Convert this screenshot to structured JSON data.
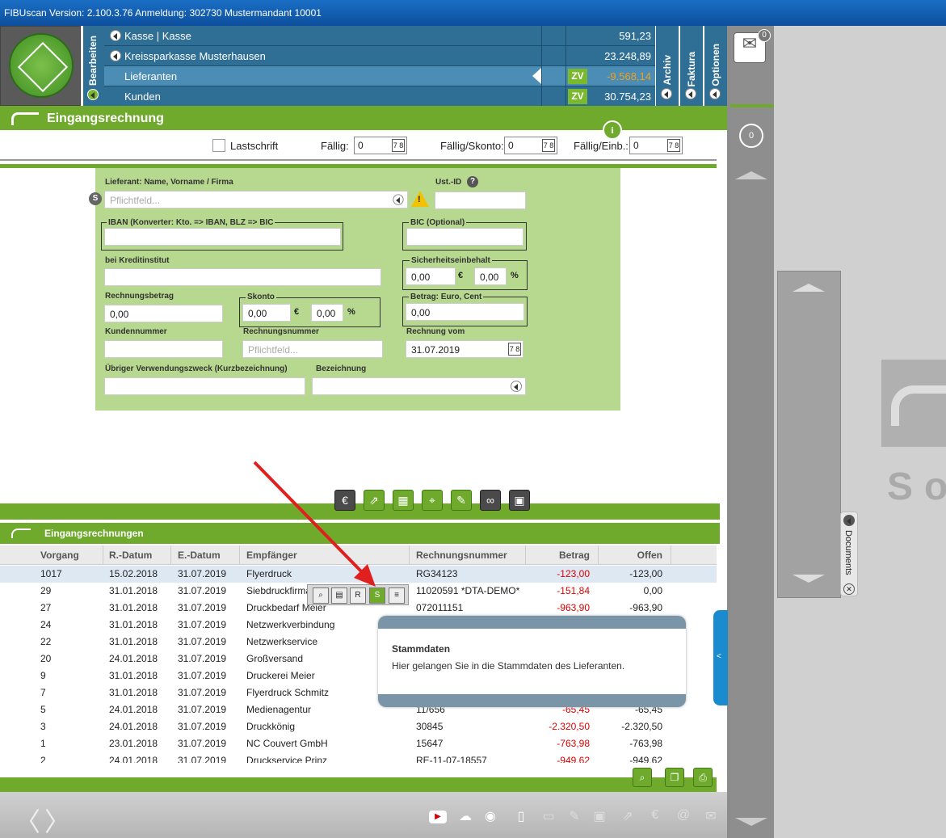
{
  "title_bar": "FIBUscan Version: 2.100.3.76 Anmeldung: 302730 Mustermandant 10001",
  "vertical_tabs": {
    "bearbeiten": "Bearbeiten",
    "archiv": "Archiv",
    "faktura": "Faktura",
    "optionen": "Optionen"
  },
  "accounts": [
    {
      "label": "Kasse | Kasse",
      "zv": "",
      "value": "591,23"
    },
    {
      "label": "Kreissparkasse Musterhausen",
      "zv": "",
      "value": "23.248,89"
    },
    {
      "label": "Lieferanten",
      "zv": "ZV",
      "value": "-9.568,14"
    },
    {
      "label": "Kunden",
      "zv": "ZV",
      "value": "30.754,23"
    }
  ],
  "colors": {
    "accent_green": "#6faa2c",
    "header_blue": "#2f6f95",
    "negative": "#dd0000",
    "orange_value": "#f0a020"
  },
  "section_title": "Eingangsrechnung",
  "filter": {
    "lastschrift": "Lastschrift",
    "faellig_label": "Fällig:",
    "faellig_value": "0",
    "skonto_label": "Fällig/Skonto:",
    "skonto_value": "0",
    "einb_label": "Fällig/Einb.:",
    "einb_value": "0",
    "cal_glyph": "7 8"
  },
  "form": {
    "lieferant_label": "Lieferant: Name, Vorname / Firma",
    "lieferant_placeholder": "Pflichtfeld...",
    "s_badge": "S",
    "ustid_label": "Ust.-ID",
    "help": "?",
    "iban_label": "IBAN (Konverter: Kto. => IBAN, BLZ => BIC",
    "bic_label": "BIC (Optional)",
    "kredit_label": "bei Kreditinstitut",
    "sicherheit_label": "Sicherheitseinbehalt",
    "sich_eur": "0,00",
    "sich_pct": "0,00",
    "euro_sym": "€",
    "pct_sym": "%",
    "betrag_label": "Rechnungsbetrag",
    "betrag_value": "0,00",
    "skonto_label": "Skonto",
    "skonto_eur": "0,00",
    "skonto_pct": "0,00",
    "betrag_ec_label": "Betrag: Euro, Cent",
    "betrag_ec_value": "0,00",
    "kundennr_label": "Kundennummer",
    "rechnr_label": "Rechnungsnummer",
    "rechnr_placeholder": "Pflichtfeld...",
    "rechvom_label": "Rechnung vom",
    "rechvom_value": "31.07.2019",
    "zweck_label": "Übriger Verwendungszweck (Kurzbezeichnung)",
    "bezeichnung_label": "Bezeichnung"
  },
  "list": {
    "title": "Eingangsrechnungen",
    "columns": [
      "Vorgang",
      "R.-Datum",
      "E.-Datum",
      "Empfänger",
      "Rechnungsnummer",
      "Betrag",
      "Offen"
    ],
    "rows": [
      [
        "1017",
        "15.02.2018",
        "31.07.2019",
        "Flyerdruck",
        "RG34123",
        "-123,00",
        "-123,00"
      ],
      [
        "29",
        "31.01.2018",
        "31.07.2019",
        "Siebdruckfirma",
        "11020591 *DTA-DEMO*",
        "-151,84",
        "0,00"
      ],
      [
        "27",
        "31.01.2018",
        "31.07.2019",
        "Druckbedarf Meier",
        "072011151",
        "-963,90",
        "-963,90"
      ],
      [
        "24",
        "31.01.2018",
        "31.07.2019",
        "Netzwerkverbindung",
        "",
        "",
        ""
      ],
      [
        "22",
        "31.01.2018",
        "31.07.2019",
        "Netzwerkservice",
        "",
        "",
        ""
      ],
      [
        "20",
        "24.01.2018",
        "31.07.2019",
        "Großversand",
        "",
        "",
        ""
      ],
      [
        "9",
        "31.01.2018",
        "31.07.2019",
        "Druckerei Meier",
        "",
        "",
        ""
      ],
      [
        "7",
        "31.01.2018",
        "31.07.2019",
        "Flyerdruck Schmitz",
        "",
        "",
        ""
      ],
      [
        "5",
        "24.01.2018",
        "31.07.2019",
        "Medienagentur",
        "11/656",
        "-65,45",
        "-65,45"
      ],
      [
        "3",
        "24.01.2018",
        "31.07.2019",
        "Druckkönig",
        "30845",
        "-2.320,50",
        "-2.320,50"
      ],
      [
        "1",
        "23.01.2018",
        "31.07.2019",
        "NC Couvert GmbH",
        "15647",
        "-763,98",
        "-763,98"
      ],
      [
        "2",
        "24.01.2018",
        "31.07.2019",
        "Druckservice Prinz",
        "RE-11-07-18557",
        "-949,62",
        "-949,62"
      ]
    ]
  },
  "tooltip": {
    "title": "Stammdaten",
    "text": "Hier gelangen Sie in die Stammdaten des Lieferanten."
  },
  "right": {
    "badge_count": "0",
    "mail_badge": "0",
    "documents": "Documents",
    "so_text": "So",
    "tab_arrow": "<"
  },
  "icons": [
    "logo-icon",
    "euro-icon",
    "export-icon",
    "basket-icon",
    "location-icon",
    "edit-icon",
    "infinity-icon",
    "save-icon",
    "search-icon",
    "copy-icon",
    "print-icon",
    "youtube-icon",
    "cloud-icon",
    "eye-icon",
    "mail-icon",
    "info-icon",
    "warning-icon"
  ]
}
